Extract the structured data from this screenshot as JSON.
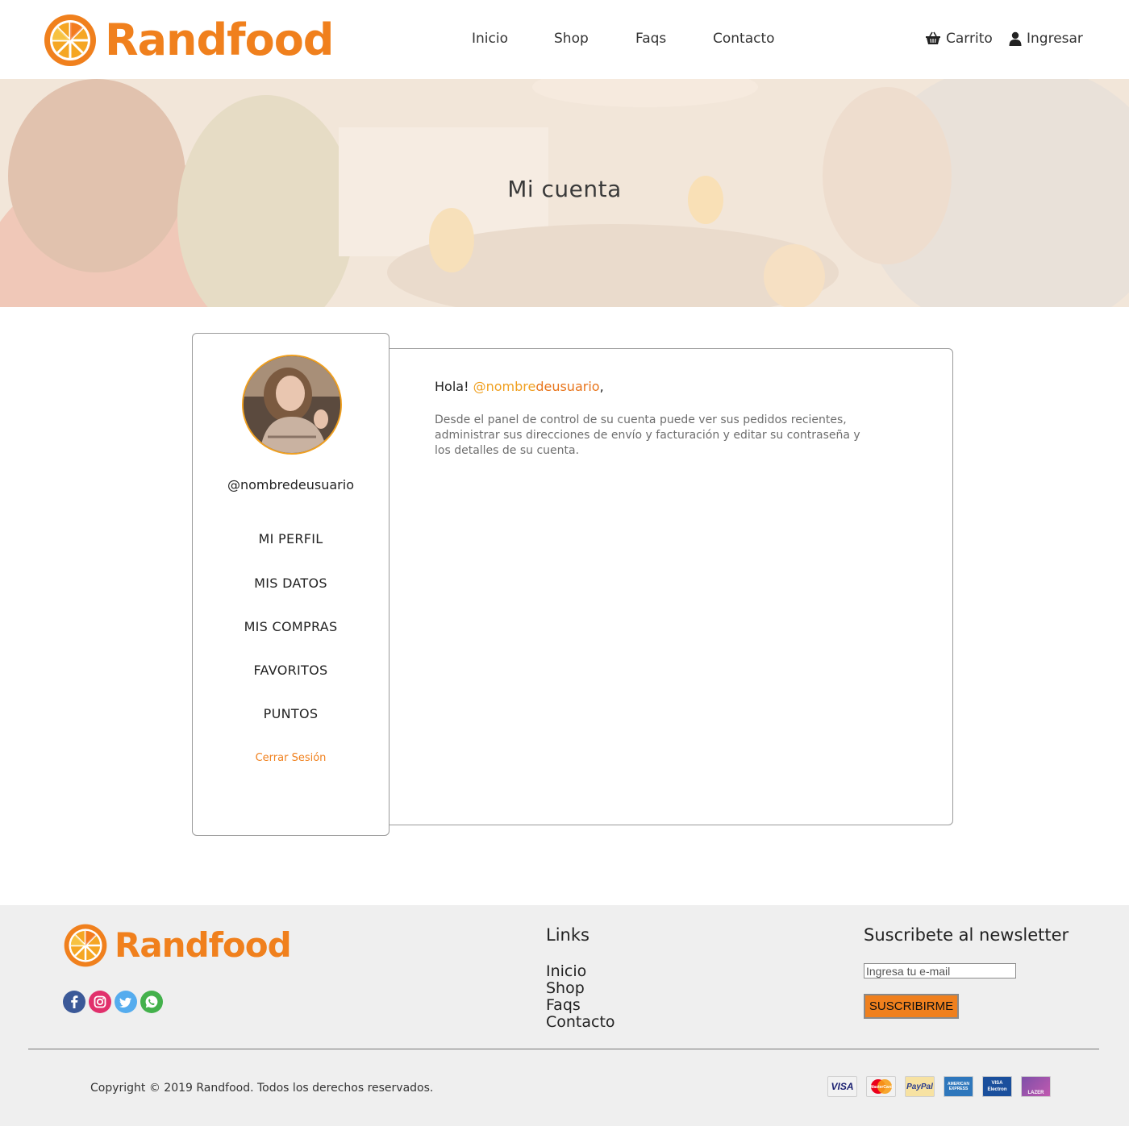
{
  "brand": {
    "name": "Randfood"
  },
  "nav": {
    "items": [
      "Inicio",
      "Shop",
      "Faqs",
      "Contacto"
    ]
  },
  "header_actions": {
    "cart": "Carrito",
    "login": "Ingresar"
  },
  "hero": {
    "title": "Mi cuenta"
  },
  "sidebar": {
    "username": "@nombredeusuario",
    "menu": [
      "MI PERFIL",
      "MIS DATOS",
      "MIS COMPRAS",
      "FAVORITOS",
      "PUNTOS"
    ],
    "logout": "Cerrar Sesión"
  },
  "main": {
    "greeting_prefix": "Hola!",
    "greeting_handle_a": "@nombre",
    "greeting_handle_b": "deusuario",
    "greeting_suffix": ",",
    "description": "Desde el panel de control de su cuenta puede ver sus pedidos recientes, administrar sus direcciones de envío y facturación y editar su contraseña y los detalles de su cuenta."
  },
  "footer": {
    "social": [
      "facebook-icon",
      "instagram-icon",
      "twitter-icon",
      "whatsapp-icon"
    ],
    "links_heading": "Links",
    "links": [
      "Inicio",
      "Shop",
      "Faqs",
      "Contacto"
    ],
    "newsletter_heading": "Suscribete al newsletter",
    "email_placeholder": "Ingresa tu e-mail",
    "subscribe_label": "SUSCRIBIRME",
    "copyright": "Copyright © 2019 Randfood. Todos los derechos reservados.",
    "payments": [
      {
        "name": "visa",
        "text": "VISA"
      },
      {
        "name": "mastercard",
        "text": "MasterCard"
      },
      {
        "name": "paypal",
        "text": "PayPal"
      },
      {
        "name": "american-express",
        "text": "AMERICAN EXPRESS"
      },
      {
        "name": "visa-electron",
        "text": "VISA Electron"
      },
      {
        "name": "lazer",
        "text": "LAZER"
      }
    ]
  },
  "colors": {
    "accent": "#f0801d",
    "accent_yellow": "#f0a020",
    "footer_bg": "#efefef"
  }
}
